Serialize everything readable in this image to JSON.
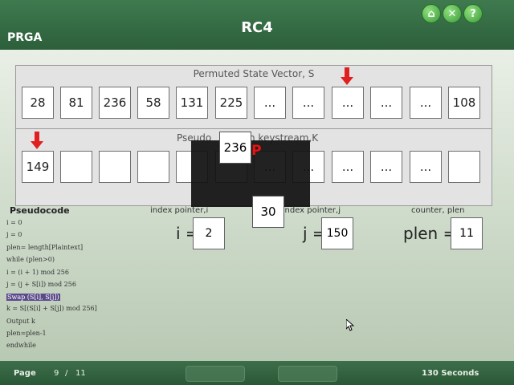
{
  "header": {
    "title": "RC4",
    "section": "PRGA"
  },
  "state_vector": {
    "caption": "Permuted State Vector, S",
    "cells": [
      "28",
      "81",
      "236",
      "58",
      "131",
      "225",
      "...",
      "...",
      "...",
      "...",
      "...",
      "108"
    ]
  },
  "keystream": {
    "caption": "Pseudo",
    "caption_tail": "n keystream,K",
    "cells": [
      "149",
      "",
      "",
      "",
      "",
      "",
      "...",
      "...",
      "...",
      "...",
      "...",
      ""
    ]
  },
  "overlay": {
    "top_value": "236",
    "swap_label": "AP",
    "bottom_value": "30"
  },
  "pointers": {
    "i_label": "index pointer,i",
    "i_sym": "i =",
    "i_val": "2",
    "j_label": "index pointer,j",
    "j_sym": "j =",
    "j_val": "150",
    "p_label": "counter, plen",
    "p_sym": "plen =",
    "p_val": "11"
  },
  "pseudocode": {
    "title": "Pseudocode",
    "lines": [
      "i = 0",
      "j = 0",
      "plen= length[Plaintext]",
      "while (plen>0)",
      "i = (i + 1) mod 256",
      "j = (j + S[i]) mod 256",
      "Swap (S[i], S[j])",
      "k = S[(S[i] + S[j]) mod 256]",
      "Output k",
      "plen=plen-1",
      "endwhile"
    ]
  },
  "footer": {
    "page_label": "Page",
    "page_current": "9",
    "page_sep": "/",
    "page_total": "11",
    "timer": "130 Seconds"
  },
  "icons": {
    "home": "home-icon",
    "close": "close-icon",
    "help": "help-icon"
  },
  "colors": {
    "header": "#2c5f3a",
    "arrow": "#e02020",
    "highlight": "#5a4a8a"
  }
}
